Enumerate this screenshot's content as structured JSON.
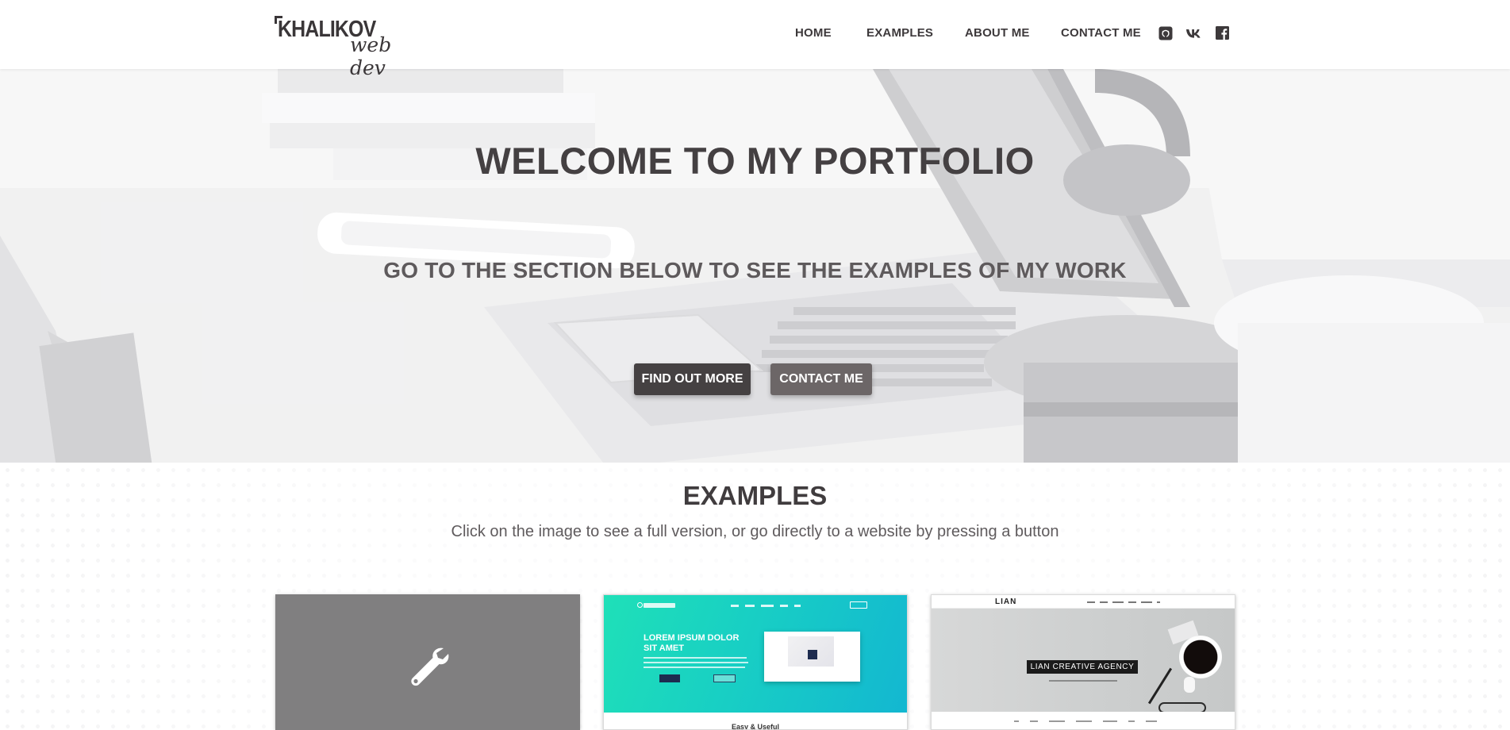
{
  "header": {
    "logo_main": "KHALIKOV",
    "logo_sub": "web dev",
    "nav": [
      "HOME",
      "EXAMPLES",
      "ABOUT ME",
      "CONTACT ME"
    ],
    "social_icons": [
      "github-icon",
      "vk-icon",
      "facebook-icon"
    ]
  },
  "hero": {
    "title": "WELCOME TO MY PORTFOLIO",
    "subtitle": "GO TO THE SECTION BELOW TO SEE THE EXAMPLES OF MY WORK",
    "primary_button": "FIND OUT MORE",
    "secondary_button": "CONTACT ME"
  },
  "examples": {
    "title": "EXAMPLES",
    "description": "Click on the image to see a full version, or go directly to a website by pressing a button",
    "cards": [
      {
        "kind": "placeholder",
        "icon": "wrench-icon"
      },
      {
        "kind": "thumbnail",
        "heading": "LOREM IPSUM DOLOR SIT AMET",
        "caption": "Easy & Useful"
      },
      {
        "kind": "thumbnail",
        "logo": "LIAN",
        "label": "LIAN CREATIVE AGENCY"
      }
    ]
  },
  "colors": {
    "text_dark": "#444042",
    "button_primary": "#454142",
    "button_secondary": "#6c6667",
    "placeholder_card": "#807f80",
    "teal_gradient_start": "#1fe0b8",
    "teal_gradient_end": "#13b7d1"
  }
}
